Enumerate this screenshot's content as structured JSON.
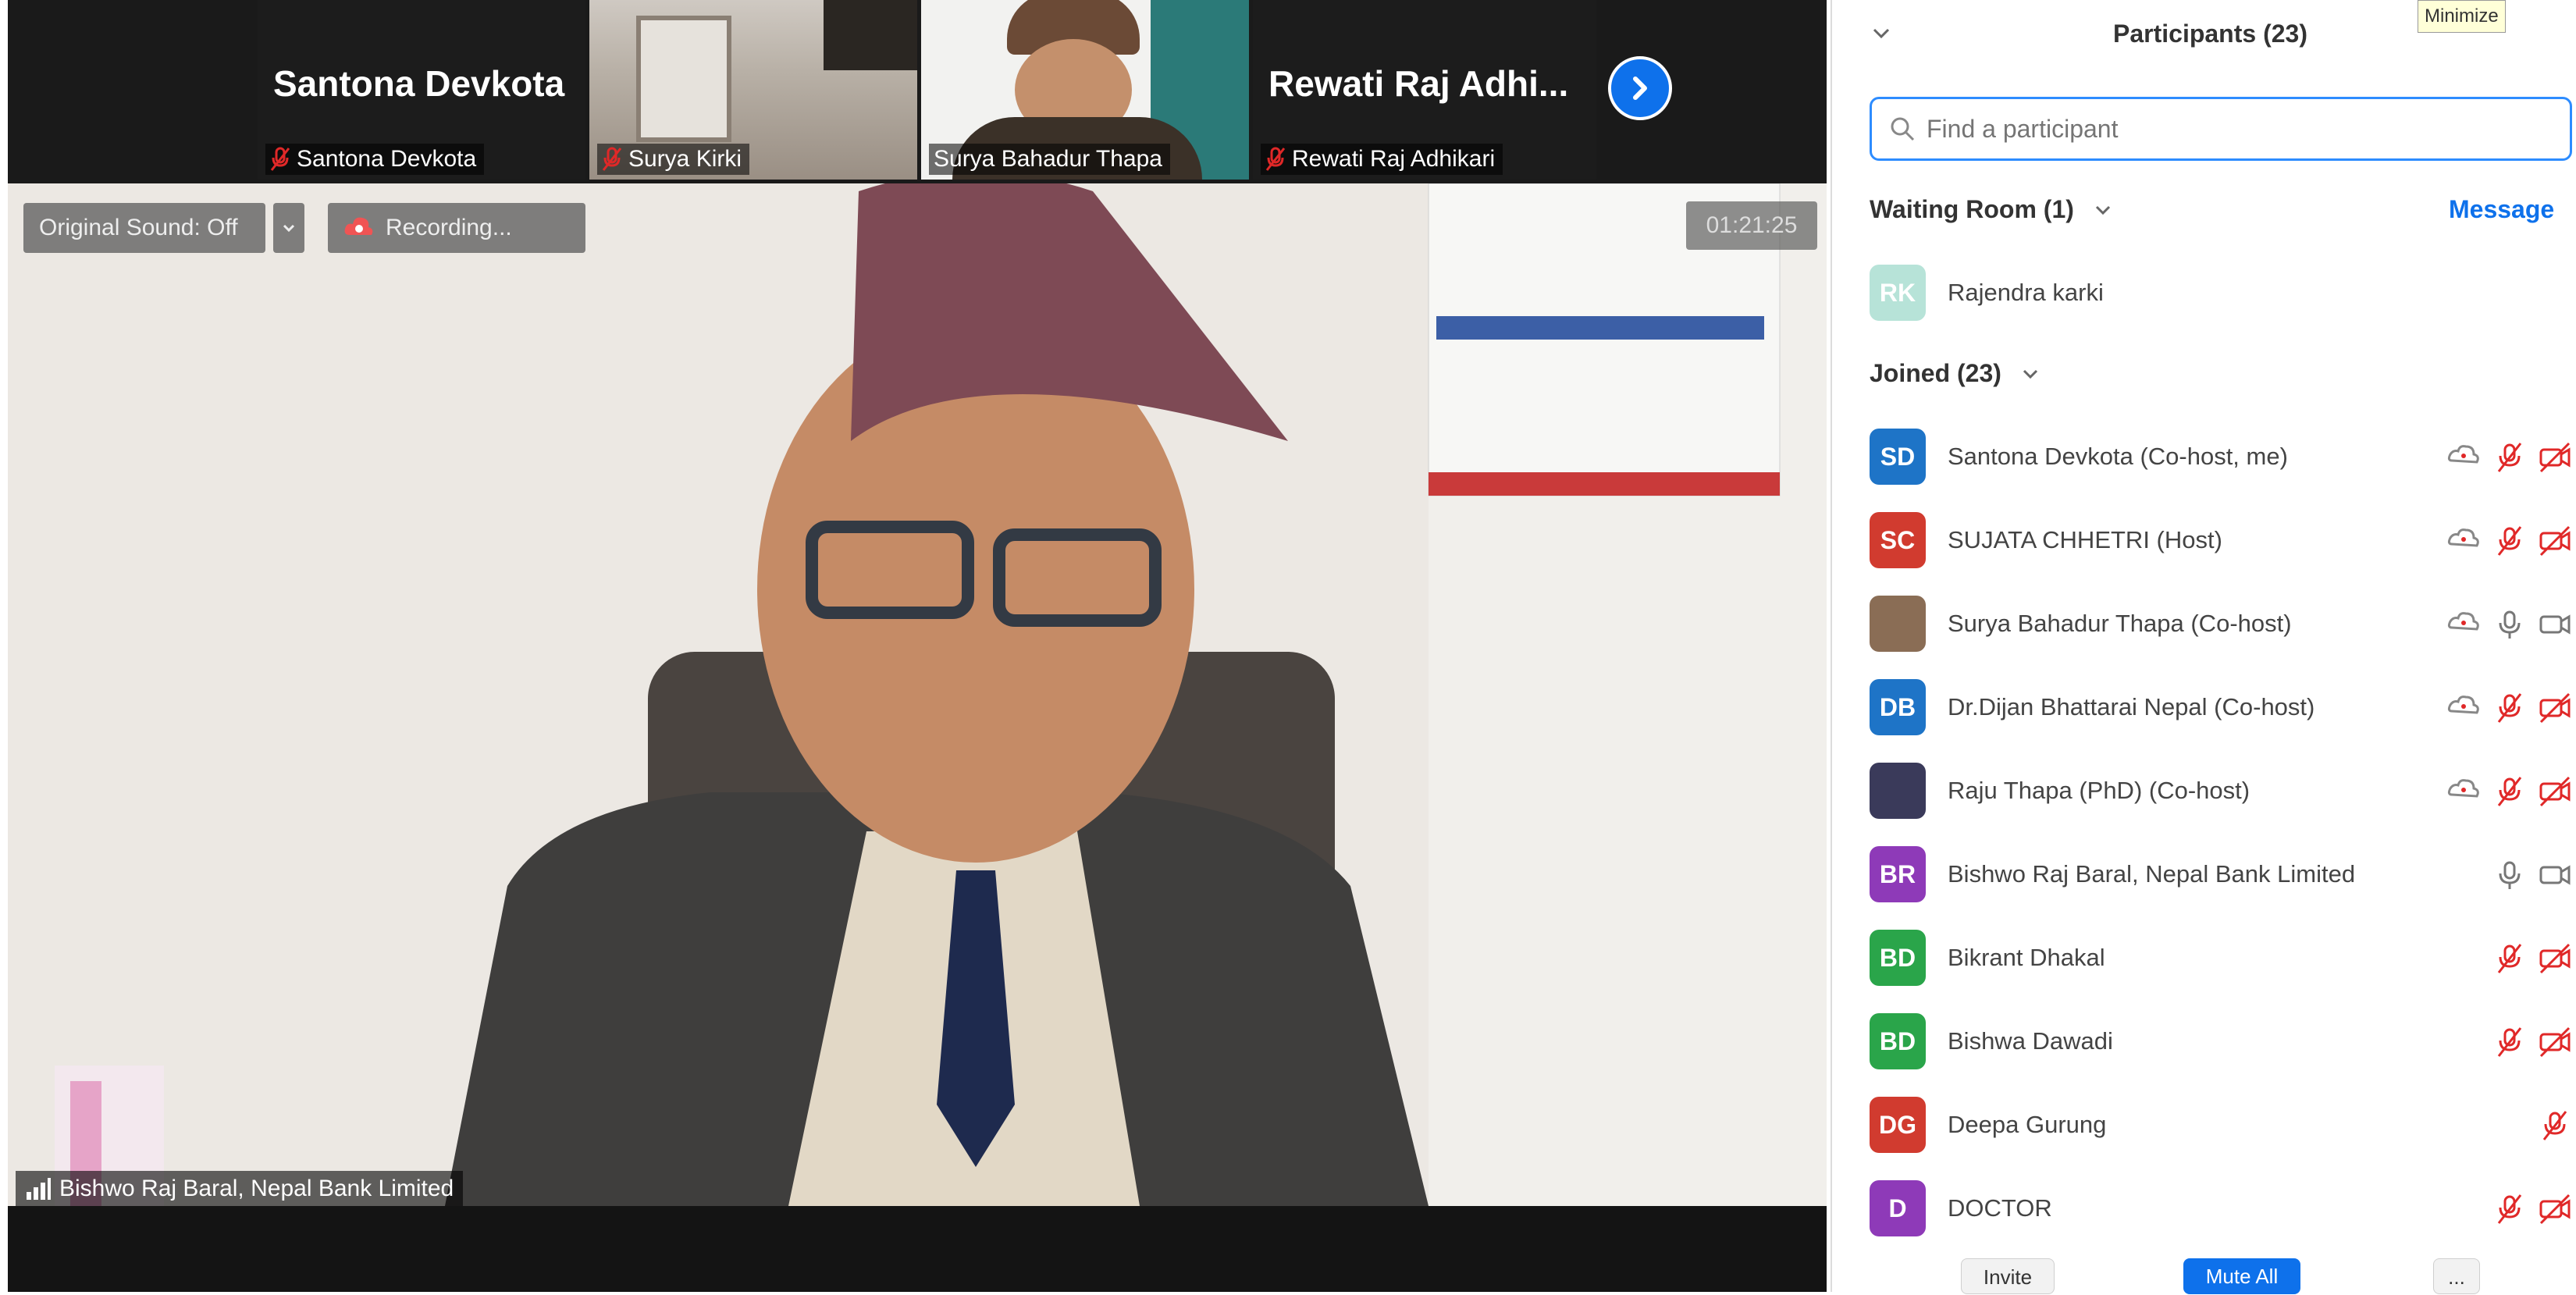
{
  "meeting": {
    "thumbnails": [
      {
        "big_name": "Santona Devkota",
        "caption": "Santona Devkota",
        "muted": true,
        "type": "name"
      },
      {
        "big_name": "",
        "caption": "Surya Kirki",
        "muted": true,
        "type": "video"
      },
      {
        "big_name": "",
        "caption": "Surya Bahadur Thapa",
        "muted": false,
        "type": "video"
      },
      {
        "big_name": "Rewati Raj Adhi...",
        "caption": "Rewati Raj Adhikari",
        "muted": true,
        "type": "name"
      }
    ],
    "original_sound": "Original Sound: Off",
    "recording": "Recording...",
    "timer": "01:21:25",
    "active_speaker": "Bishwo Raj Baral, Nepal Bank Limited"
  },
  "panel": {
    "title": "Participants (23)",
    "tooltip": "Minimize",
    "search_placeholder": "Find a participant",
    "waiting_room_label": "Waiting Room (1)",
    "message_label": "Message",
    "waiting": [
      {
        "initials": "RK",
        "name": "Rajendra karki",
        "color": "#b7e3d8"
      }
    ],
    "joined_label": "Joined (23)",
    "participants": [
      {
        "initials": "SD",
        "name": "Santona Devkota (Co-host, me)",
        "color": "#1e74c7",
        "share": true,
        "mic": "muted",
        "video": "off"
      },
      {
        "initials": "SC",
        "name": "SUJATA CHHETRI (Host)",
        "color": "#d13b2f",
        "share": true,
        "mic": "muted",
        "video": "off"
      },
      {
        "initials": "",
        "name": "Surya Bahadur Thapa (Co-host)",
        "color": "#8a6d55",
        "share": true,
        "mic": "on",
        "video": "on"
      },
      {
        "initials": "DB",
        "name": "Dr.Dijan Bhattarai Nepal (Co-host)",
        "color": "#1e74c7",
        "share": true,
        "mic": "muted",
        "video": "off"
      },
      {
        "initials": "",
        "name": "Raju Thapa (PhD) (Co-host)",
        "color": "#3a3a5a",
        "share": true,
        "mic": "muted",
        "video": "off"
      },
      {
        "initials": "BR",
        "name": "Bishwo Raj Baral, Nepal Bank Limited",
        "color": "#8e3ab8",
        "share": false,
        "mic": "on",
        "video": "on"
      },
      {
        "initials": "BD",
        "name": "Bikrant Dhakal",
        "color": "#2aa54a",
        "share": false,
        "mic": "muted",
        "video": "off"
      },
      {
        "initials": "BD",
        "name": "Bishwa Dawadi",
        "color": "#2aa54a",
        "share": false,
        "mic": "muted",
        "video": "off"
      },
      {
        "initials": "DG",
        "name": "Deepa Gurung",
        "color": "#d13b2f",
        "share": false,
        "mic": "muted",
        "video": "none"
      },
      {
        "initials": "D",
        "name": "DOCTOR",
        "color": "#8e3ab8",
        "share": false,
        "mic": "muted",
        "video": "off"
      }
    ],
    "footer": {
      "invite": "Invite",
      "mute_all": "Mute All",
      "more": "..."
    }
  }
}
